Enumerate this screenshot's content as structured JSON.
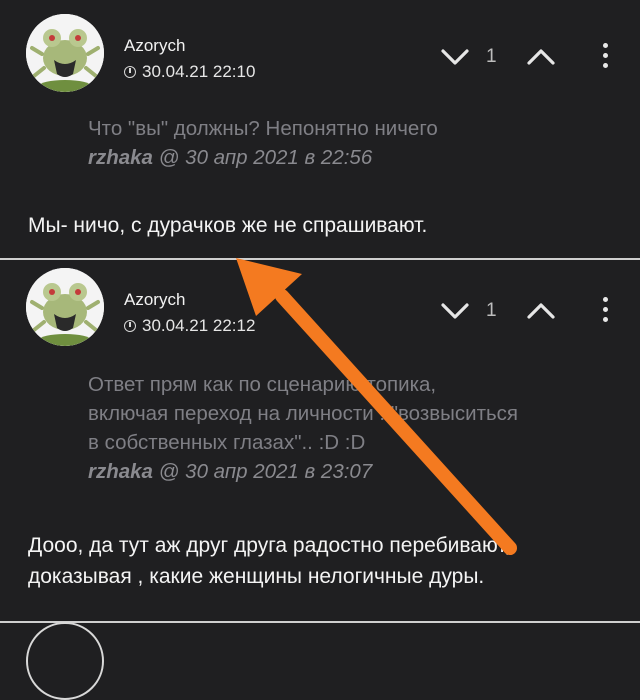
{
  "comments": [
    {
      "author": "Azorych",
      "time": "30.04.21 22:10",
      "vote_count": "1",
      "quote_text": "Что \"вы\" должны? Непонятно ничего",
      "quote_author": "rzhaka",
      "quote_date": "@ 30 апр 2021 в 22:56",
      "body": "Мы- ничо, с дурачков же не спрашивают."
    },
    {
      "author": "Azorych",
      "time": "30.04.21 22:12",
      "vote_count": "1",
      "quote_lines": [
        "Ответ прям как по сценарию топика,",
        "включая переход на личности : \"возвыситься",
        "в собственных глазах\".. :D :D"
      ],
      "quote_author": "rzhaka",
      "quote_date": "@ 30 апр 2021 в 23:07",
      "body_lines": [
        "Дооо, да тут аж друг друга радостно перебивают,",
        "доказывая , какие женщины нелогичные дуры."
      ]
    }
  ],
  "colors": {
    "background": "#1f1f21",
    "annotation_arrow": "#f47a20"
  },
  "icons": [
    "avatar-frog",
    "clock-icon",
    "chevron-down-icon",
    "chevron-up-icon",
    "more-vertical-icon"
  ]
}
